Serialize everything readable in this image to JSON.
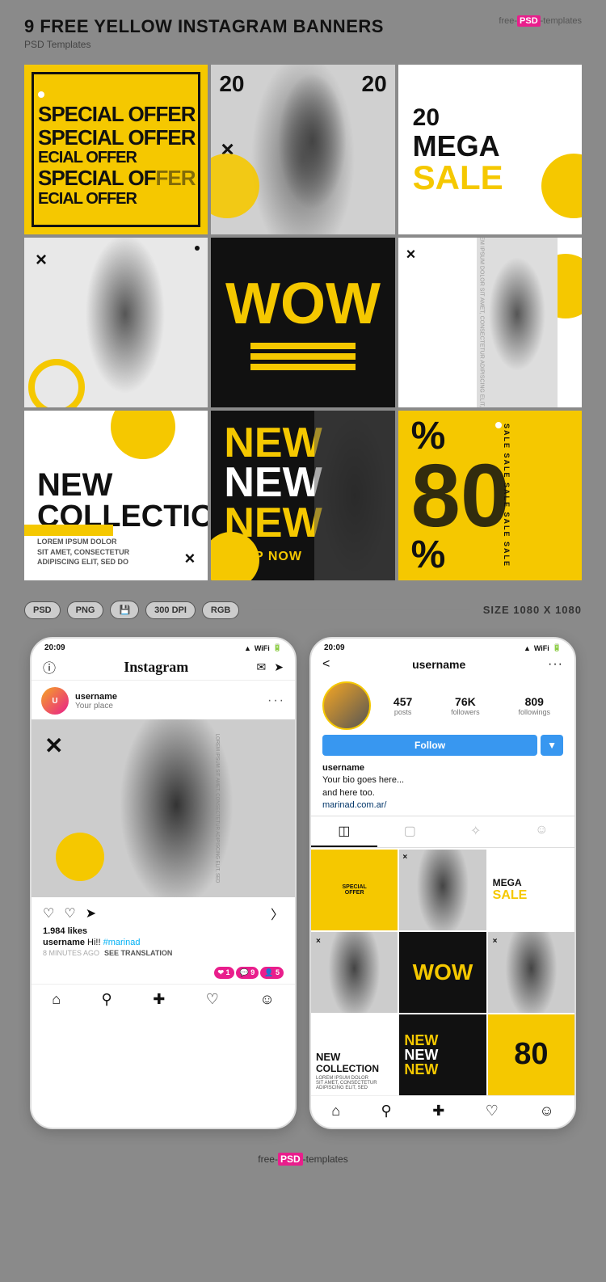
{
  "header": {
    "title": "9 FREE YELLOW INSTAGRAM BANNERS",
    "subtitle": "PSD Templates",
    "logo": "free-PSD-templates"
  },
  "banners": [
    {
      "id": "b1",
      "text1": "SPECIAL OFFER",
      "text2": "SPECIAL OFFER",
      "text3": "ECIAL OFFER",
      "text4": "SPECIAL OF FER",
      "text5": "ECIAL OFFER"
    },
    {
      "id": "b2",
      "num1": "20",
      "num2": "20",
      "x": "×"
    },
    {
      "id": "b3",
      "num": "20",
      "mega": "MEGA",
      "sale": "SALE"
    },
    {
      "id": "b4",
      "x": "×"
    },
    {
      "id": "b5",
      "wow": "WOW"
    },
    {
      "id": "b6",
      "x": "×",
      "sidetext": "LOREM IPSUM DOLOR SIT AMET, CONSECTETUR ADIPISCING ELIT, SED"
    },
    {
      "id": "b7",
      "new_text": "NEW",
      "collection": "COLLECTION",
      "body": "LOREM IPSUM DOLOR\nSIT AMET, CONSECTETUR\nADIPISCING ELIT, SED DO",
      "x": "×"
    },
    {
      "id": "b8",
      "new1": "NEW",
      "new2": "NEW",
      "new3": "NEW",
      "shop": "SHOP NOW"
    },
    {
      "id": "b9",
      "percent1": "%",
      "eighty": "80",
      "percent2": "%",
      "sale_text": "SALE SALE SALE SALE SALE"
    }
  ],
  "format_bar": {
    "badges": [
      "PSD",
      "PNG",
      "300 DPI",
      "RGB"
    ],
    "size_label": "SIZE 1080 X 1080"
  },
  "phone1": {
    "status_time": "20:09",
    "app_name": "Instagram",
    "username": "username",
    "user_place": "Your place",
    "likes": "1.984 likes",
    "caption_user": "username",
    "caption_text": "Hi!! #marinad",
    "time_ago": "8 MINUTES AGO",
    "see_translation": "SEE TRANSLATION",
    "notifications": [
      "1",
      "9",
      "5"
    ]
  },
  "phone2": {
    "status_time": "20:09",
    "username": "username",
    "stats": {
      "posts": "457",
      "posts_label": "posts",
      "followers": "76K",
      "followers_label": "followers",
      "following": "809",
      "following_label": "followings"
    },
    "follow_btn": "Follow",
    "bio_name": "username",
    "bio_text": "Your bio goes here...\nand here too.",
    "bio_link": "marinad.com.ar/"
  },
  "footer": {
    "logo": "free-PSD-templates"
  }
}
